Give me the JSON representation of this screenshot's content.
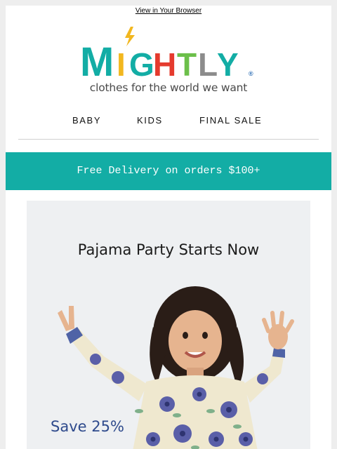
{
  "header": {
    "browser_link": "View in Your Browser",
    "logo_letters": [
      "M",
      "I",
      "G",
      "H",
      "T",
      "L",
      "Y"
    ],
    "logo_registered": "®",
    "tagline": "clothes for the world we want"
  },
  "nav": {
    "items": [
      {
        "label": "BABY"
      },
      {
        "label": "KIDS"
      },
      {
        "label": "FINAL SALE"
      }
    ]
  },
  "promo_bar": {
    "text": "Free Delivery on orders $100+"
  },
  "hero": {
    "title": "Pajama Party Starts Now",
    "offer": "Save 25%"
  },
  "colors": {
    "brand_teal": "#13ada5",
    "logo_yellow": "#f2b71f",
    "logo_red": "#e53b2e",
    "logo_green": "#6cbf4a",
    "logo_blue": "#2f6fb6",
    "logo_gray": "#8c8c8c"
  }
}
